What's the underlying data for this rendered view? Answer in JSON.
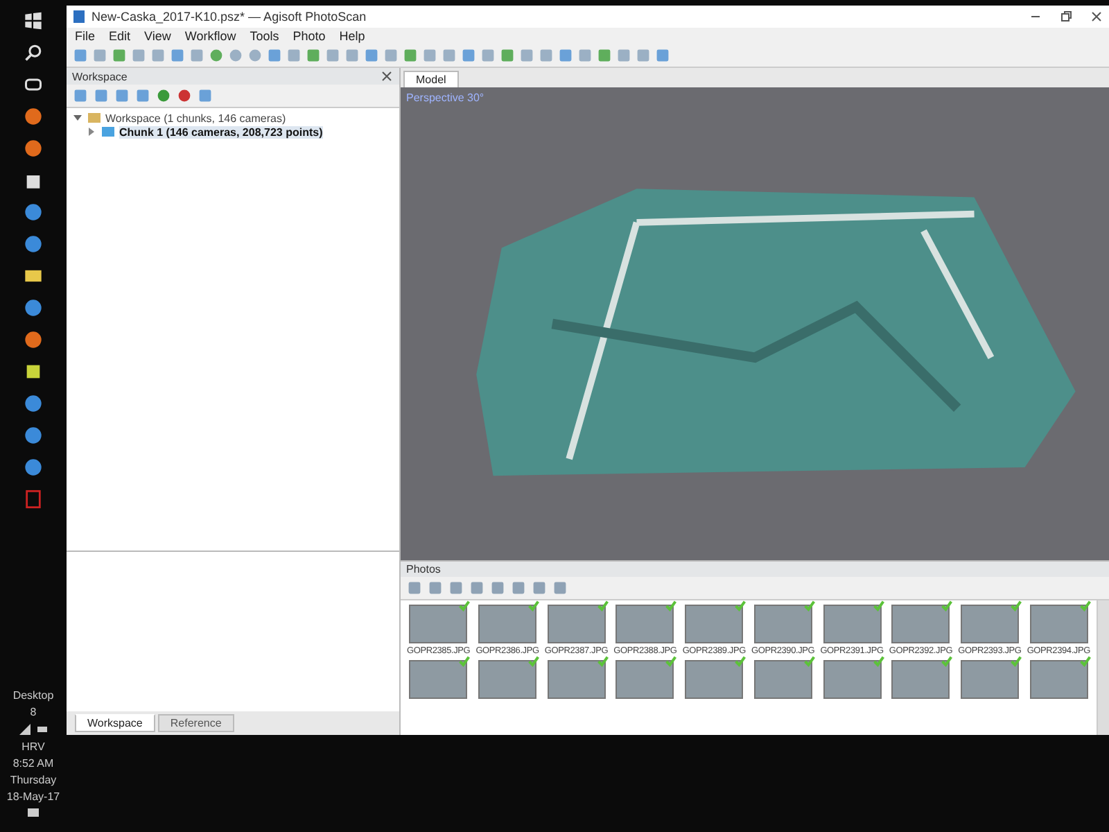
{
  "taskbar": {
    "desktop_label": "Desktop",
    "desktop_number": "8",
    "language": "HRV",
    "time": "8:52 AM",
    "day": "Thursday",
    "date": "18-May-17"
  },
  "window": {
    "title": "New-Caska_2017-K10.psz* — Agisoft PhotoScan"
  },
  "menu": [
    "File",
    "Edit",
    "View",
    "Workflow",
    "Tools",
    "Photo",
    "Help"
  ],
  "workspace": {
    "title": "Workspace",
    "tree": [
      {
        "label": "Workspace (1 chunks, 146 cameras)",
        "expanded": true,
        "selected": false,
        "children": [
          {
            "label": "Chunk 1 (146 cameras, 208,723 points)",
            "expanded": false,
            "selected": true
          }
        ]
      }
    ]
  },
  "bottom_tabs": [
    {
      "label": "Workspace",
      "selected": true
    },
    {
      "label": "Reference",
      "selected": false
    }
  ],
  "view_tabs": [
    {
      "label": "Model",
      "selected": true
    }
  ],
  "viewport": {
    "label": "Perspective 30°"
  },
  "photos": {
    "title": "Photos",
    "items": [
      {
        "label": "GOPR2385.JPG",
        "aligned": true
      },
      {
        "label": "GOPR2386.JPG",
        "aligned": true
      },
      {
        "label": "GOPR2387.JPG",
        "aligned": true
      },
      {
        "label": "GOPR2388.JPG",
        "aligned": true
      },
      {
        "label": "GOPR2389.JPG",
        "aligned": true
      },
      {
        "label": "GOPR2390.JPG",
        "aligned": true
      },
      {
        "label": "GOPR2391.JPG",
        "aligned": true
      },
      {
        "label": "GOPR2392.JPG",
        "aligned": true
      },
      {
        "label": "GOPR2393.JPG",
        "aligned": true
      },
      {
        "label": "GOPR2394.JPG",
        "aligned": true
      },
      {
        "aligned": true
      },
      {
        "aligned": true
      },
      {
        "aligned": true
      },
      {
        "aligned": true
      },
      {
        "aligned": true
      },
      {
        "aligned": true
      },
      {
        "aligned": true
      },
      {
        "aligned": true
      },
      {
        "aligned": true
      },
      {
        "aligned": true
      }
    ]
  }
}
